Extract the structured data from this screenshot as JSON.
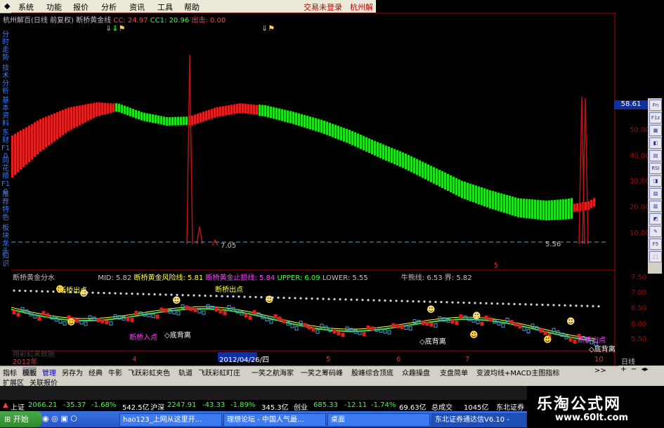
{
  "menu": {
    "items": [
      "系统",
      "功能",
      "报价",
      "分析",
      "资讯",
      "工具",
      "帮助"
    ],
    "login_status": "交易未登录",
    "broker": "杭州解"
  },
  "title_line": {
    "security": "杭州解百(日线 前复权)",
    "indicator": "断桥黄金线",
    "cc": "CC: 24.97",
    "cc1": "CC1: 20.96",
    "exit": "出击: 0.00"
  },
  "left_tabs": [
    "分时走势",
    "技术分析",
    "基本资料",
    "东财F10",
    "同花顺F10",
    "推荐特色",
    "板块龙头",
    "知识"
  ],
  "price_axis": {
    "last_price": "58.61",
    "ticks": [
      "50.00",
      "40.00",
      "30.00",
      "20.00",
      "10.00"
    ]
  },
  "price_labels": {
    "low_left": "7.05",
    "low_right": "5.56",
    "marker": "5"
  },
  "sub_header": {
    "name": "断桥黄金分水",
    "mid": "MID: 5.82",
    "risk_line": "断桥黄金风险线: 5.81",
    "stop_line": "断桥黄金止损线: 5.84",
    "upper": "UPPER: 6.09",
    "lower": "LOWER: 5.55",
    "niu_xiong": "牛熊线: 6.53",
    "jie": "界: 5.82"
  },
  "sub_axis": {
    "ticks": [
      "7.50",
      "7.00",
      "6.50",
      "6.00",
      "5.50"
    ]
  },
  "annotations": {
    "break_out_1": "断桥出点",
    "break_out_2": "断桥出点",
    "break_out_3": "断桥出点",
    "break_in_1": "断桥入点",
    "break_in_2": "断桥入点",
    "back_water_1": "◇底背离",
    "back_water_2": "◇底背离",
    "back_water_3": "◇底背离",
    "watermark_text": "用彩虹来数据"
  },
  "time_axis": {
    "year": "2012年",
    "marks": [
      "4",
      "5",
      "6",
      "7",
      "10"
    ],
    "cursor_date": "2012/04/26/四",
    "period": "日线"
  },
  "tabs_row1": [
    "指标",
    "模板",
    "管理",
    "另存为",
    "经典",
    "牛影",
    "飞跃彩虹夹色",
    "轨道",
    "飞跃彩虹盯庄",
    "一笑之航海家",
    "一笑之筹码峰",
    "股峰综合顶底",
    "众趣操盘",
    "支盘简单",
    "变波均线+MACD主图指标",
    ">>"
  ],
  "tabs_row2": [
    "扩展区",
    "关联报价"
  ],
  "right_toolbar": [
    "Fn",
    "F1z",
    "",
    "",
    "",
    "RSI",
    "",
    "",
    "",
    "",
    "F5",
    "",
    ""
  ],
  "ticker": {
    "sh_label": "上证",
    "sh_value": "2066.21",
    "sh_change": "-35.37",
    "sh_pct": "-1.68%",
    "sh_amount": "542.5亿",
    "sz_label": "沪深",
    "sz_value": "2247.91",
    "sz_change": "-43.33",
    "sz_pct": "-1.89%",
    "sz_amount": "345.3亿",
    "cy_label": "创业",
    "cy_value": "685.33",
    "cy_change": "-12.11",
    "cy_pct": "-1.74%",
    "cy_amount": "69.63亿",
    "total_label": "总成交",
    "total_value": "1045亿",
    "broker": "东北证券"
  },
  "taskbar": {
    "start": "开始",
    "tasks": [
      "hao123_上网从这里开...",
      "理想论坛 - 中国人气最...",
      "桌面",
      "东北证券通达信V6.10 -"
    ]
  },
  "watermark": {
    "brand": "乐淘公式网",
    "url": "www.60lt.com"
  },
  "colors": {
    "up": "#ff2020",
    "down": "#20ff20",
    "axis": "#b00000",
    "yellow": "#ffff40"
  }
}
